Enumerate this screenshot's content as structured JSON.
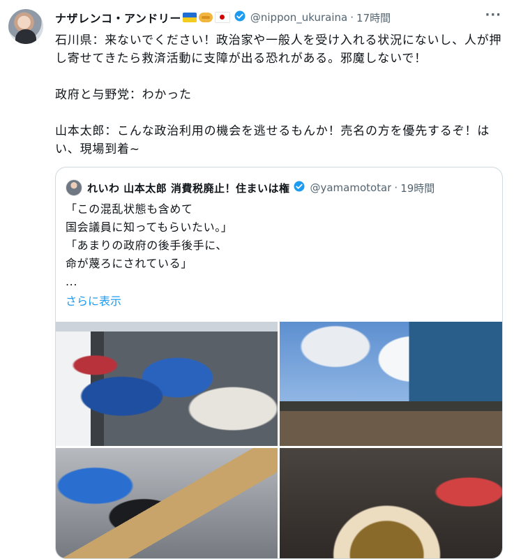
{
  "tweet": {
    "display_name": "ナザレンコ・アンドリー",
    "handle": "@nippon_ukuraina",
    "time": "17時間",
    "more_label": "···",
    "text": "石川県：来ないでください！政治家や一般人を受け入れる状況にないし、人が押し寄せてきたら救済活動に支障が出る恐れがある。邪魔しないで！\n\n政府と与野党：わかった\n\n山本太郎：こんな政治利用の機会を逃せるもんか！売名の方を優先するぞ！はい、現場到着~",
    "emoji_icons": [
      "ukraine-flag-icon",
      "handshake-icon",
      "japan-flag-icon"
    ]
  },
  "quote": {
    "display_name": "れいわ 山本太郎 消費税廃止！住まいは権",
    "handle": "@yamamototar",
    "time": "19時間",
    "text": "「この混乱状態も含めて\n国会議員に知ってもらいたい。」\n「あまりの政府の後手後手に、\n命が蔑ろにされている」\n...",
    "show_more": "さらに表示",
    "media": [
      "car-loaded-with-blue-bags-photo",
      "damaged-coastal-houses-photo",
      "tent-and-person-photo",
      "bowl-of-food-photo"
    ]
  },
  "colors": {
    "text": "#0f1419",
    "secondary": "#536471",
    "link": "#1d9bf0",
    "border": "#cfd9de",
    "verified": "#1d9bf0"
  }
}
